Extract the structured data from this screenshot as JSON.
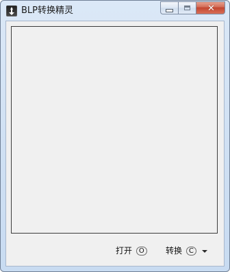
{
  "window": {
    "title": "BLP转换精灵",
    "icon": "app-icon",
    "buttons": {
      "minimize_icon": "minimize-icon",
      "maximize_icon": "maximize-icon",
      "close_icon": "close-icon"
    }
  },
  "main": {
    "preview_panel": ""
  },
  "actions": {
    "open": {
      "label": "打开",
      "hotkey": "O"
    },
    "convert": {
      "label": "转换",
      "hotkey": "C",
      "dropdown_icon": "dropdown-arrow-icon"
    }
  }
}
